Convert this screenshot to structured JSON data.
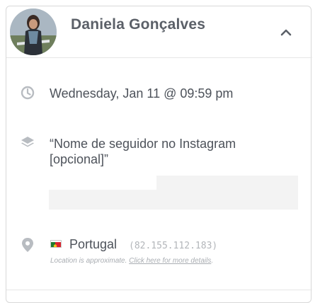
{
  "user": {
    "name": "Daniela Gonçalves"
  },
  "event": {
    "datetime": "Wednesday, Jan 11 @ 09:59 pm"
  },
  "question": {
    "prompt": "“Nome de seguidor no Instagram [opcional]”"
  },
  "location": {
    "country": "Portugal",
    "ip": "(82.155.112.183)",
    "note_prefix": "Location is approximate. ",
    "note_link": "Click here for more details",
    "note_suffix": "."
  },
  "icons": {
    "time": "clock-icon",
    "question": "layers-icon",
    "location": "map-pin-icon",
    "collapse": "chevron-up-icon",
    "flag": "portugal-flag-icon"
  },
  "colors": {
    "icon": "#b8bcc1",
    "text": "#4d525a",
    "muted": "#a9adb2",
    "border": "#d8d8d8"
  }
}
